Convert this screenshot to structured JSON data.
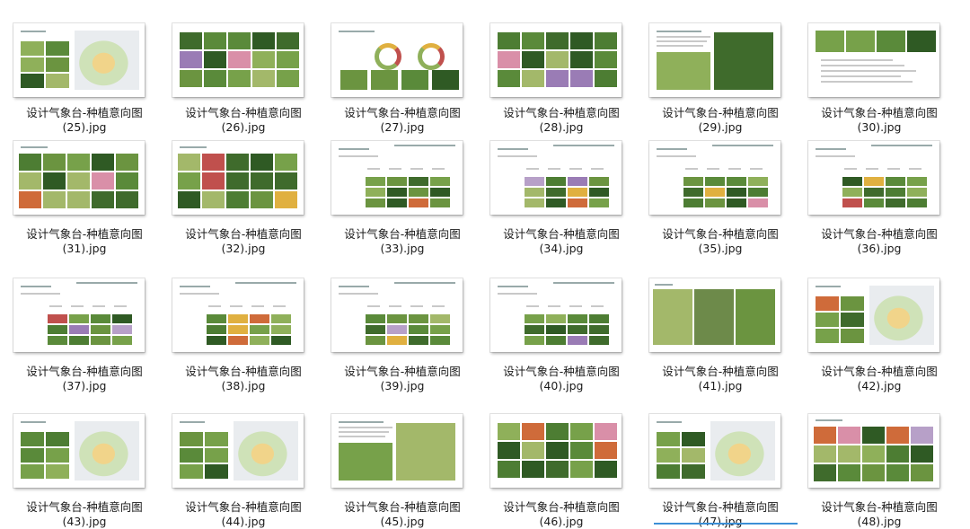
{
  "folder": {
    "items": [
      {
        "name": "设计气象台-种植意向图",
        "index": "(25).jpg",
        "layout": "plan"
      },
      {
        "name": "设计气象台-种植意向图",
        "index": "(26).jpg",
        "layout": "photos"
      },
      {
        "name": "设计气象台-种植意向图",
        "index": "(27).jpg",
        "layout": "diagram"
      },
      {
        "name": "设计气象台-种植意向图",
        "index": "(28).jpg",
        "layout": "photos"
      },
      {
        "name": "设计气象台-种植意向图",
        "index": "(29).jpg",
        "layout": "textphoto"
      },
      {
        "name": "设计气象台-种植意向图",
        "index": "(30).jpg",
        "layout": "sparse"
      },
      {
        "name": "设计气象台-种植意向图",
        "index": "(31).jpg",
        "layout": "trees"
      },
      {
        "name": "设计气象台-种植意向图",
        "index": "(32).jpg",
        "layout": "trees"
      },
      {
        "name": "设计气象台-种植意向图",
        "index": "(33).jpg",
        "layout": "table"
      },
      {
        "name": "设计气象台-种植意向图",
        "index": "(34).jpg",
        "layout": "table"
      },
      {
        "name": "设计气象台-种植意向图",
        "index": "(35).jpg",
        "layout": "table"
      },
      {
        "name": "设计气象台-种植意向图",
        "index": "(36).jpg",
        "layout": "table"
      },
      {
        "name": "设计气象台-种植意向图",
        "index": "(37).jpg",
        "layout": "table"
      },
      {
        "name": "设计气象台-种植意向图",
        "index": "(38).jpg",
        "layout": "table"
      },
      {
        "name": "设计气象台-种植意向图",
        "index": "(39).jpg",
        "layout": "table"
      },
      {
        "name": "设计气象台-种植意向图",
        "index": "(40).jpg",
        "layout": "table"
      },
      {
        "name": "设计气象台-种植意向图",
        "index": "(41).jpg",
        "layout": "bigphoto"
      },
      {
        "name": "设计气象台-种植意向图",
        "index": "(42).jpg",
        "layout": "plan"
      },
      {
        "name": "设计气象台-种植意向图",
        "index": "(43).jpg",
        "layout": "plan"
      },
      {
        "name": "设计气象台-种植意向图",
        "index": "(44).jpg",
        "layout": "plan"
      },
      {
        "name": "设计气象台-种植意向图",
        "index": "(45).jpg",
        "layout": "textphoto"
      },
      {
        "name": "设计气象台-种植意向图",
        "index": "(46).jpg",
        "layout": "photos"
      },
      {
        "name": "设计气象台-种植意向图",
        "index": "(47).jpg",
        "layout": "plan"
      },
      {
        "name": "设计气象台-种植意向图",
        "index": "(48).jpg",
        "layout": "trees"
      }
    ],
    "palette": {
      "greens": [
        "#3f6b2c",
        "#5a8a3a",
        "#77a14a",
        "#2f5a24",
        "#8fb05a",
        "#4d7d33",
        "#a3b86a",
        "#6b9440"
      ],
      "accents": [
        "#c0504d",
        "#d98fa8",
        "#b7a0c8",
        "#e0b040",
        "#cf6b3a",
        "#9a7cb5"
      ],
      "selection": "#3c8fd6"
    }
  }
}
